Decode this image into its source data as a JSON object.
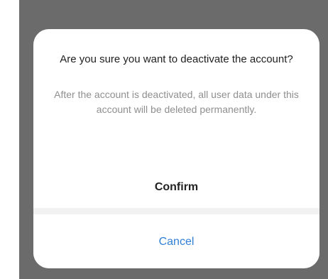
{
  "dialog": {
    "title": "Are you sure you want to deactivate the account?",
    "message": "After the account is deactivated, all user data under this account will be deleted permanently.",
    "confirm_label": "Confirm",
    "cancel_label": "Cancel"
  },
  "colors": {
    "overlay": "#6b6b6b",
    "dialog_background": "#ffffff",
    "title_text": "#1f1f1f",
    "message_text": "#8f8f8f",
    "confirm_text": "#222222",
    "cancel_text": "#2f7fd6",
    "divider": "#f2f2f2"
  }
}
